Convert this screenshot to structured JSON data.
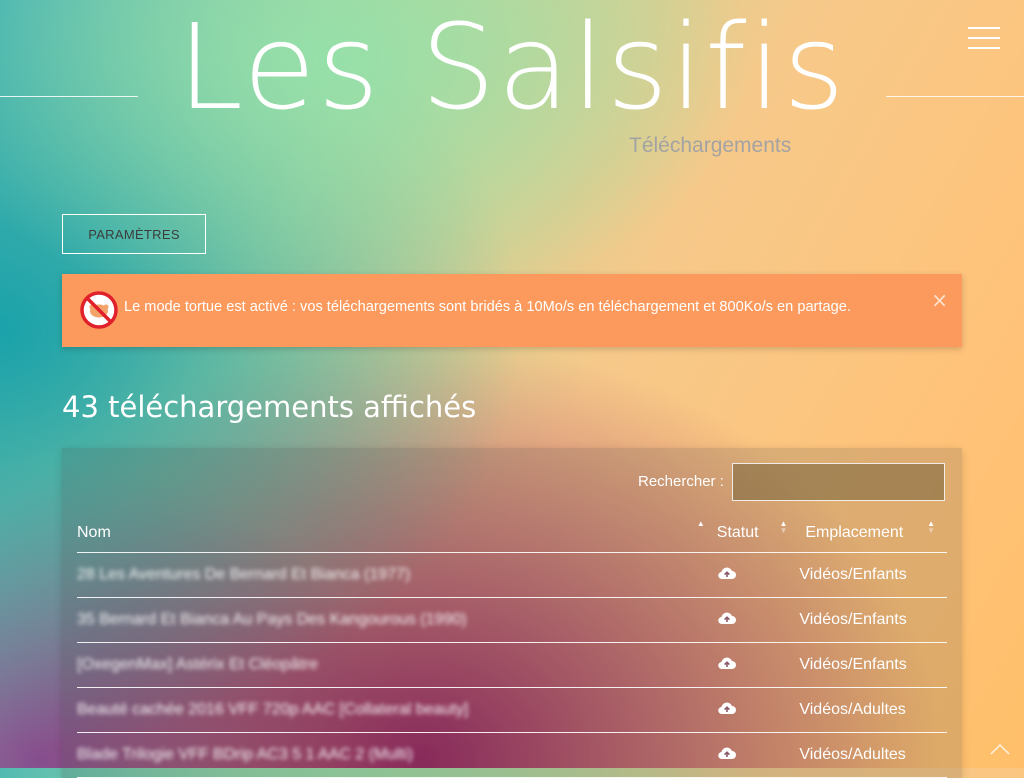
{
  "header": {
    "site_title": "Les Salsifis",
    "subtitle": "Téléchargements"
  },
  "toolbar": {
    "params_label": "PARAMÈTRES"
  },
  "alert": {
    "message": "Le mode tortue est activé : vos téléchargements sont bridés à 10Mo/s en téléchargement et 800Ko/s en partage.",
    "close_symbol": "×",
    "icon": "turtle-disabled-icon"
  },
  "downloads": {
    "count_heading": "43 téléchargements affichés",
    "search_label": "Rechercher :",
    "search_value": "",
    "columns": {
      "name": "Nom",
      "status": "Statut",
      "location": "Emplacement"
    },
    "rows": [
      {
        "name": "28 Les Aventures De Bernard Et Bianca (1977)",
        "status_icon": "cloud-upload-icon",
        "location": "Vidéos/Enfants"
      },
      {
        "name": "35 Bernard Et Bianca Au Pays Des Kangourous (1990)",
        "status_icon": "cloud-upload-icon",
        "location": "Vidéos/Enfants"
      },
      {
        "name": "[OxegenMax] Astérix Et Cléopâtre",
        "status_icon": "cloud-upload-icon",
        "location": "Vidéos/Enfants"
      },
      {
        "name": "Beauté cachée 2016 VFF 720p AAC [Collateral beauty]",
        "status_icon": "cloud-upload-icon",
        "location": "Vidéos/Adultes"
      },
      {
        "name": "Blade Trilogie VFF BDrip AC3 5 1 AAC 2 (Multi)",
        "status_icon": "cloud-upload-icon",
        "location": "Vidéos/Adultes"
      }
    ]
  },
  "colors": {
    "alert_bg": "#fb9a5c",
    "subtitle": "#a3a3a3",
    "turtle_icon_red": "#e0202a"
  }
}
